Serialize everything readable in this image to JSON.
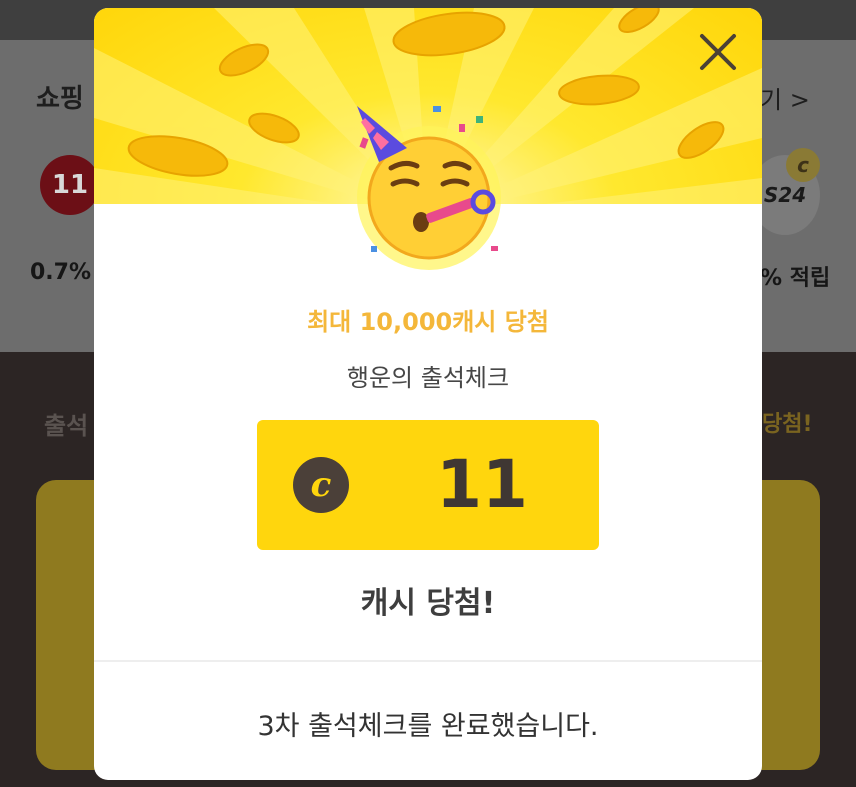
{
  "background": {
    "section_title": "쇼핑",
    "more_link": "기 >",
    "left_store_logo": "11",
    "right_store_logo": "S24",
    "right_coin_symbol": "c",
    "left_reward": "0.7%",
    "right_reward": "% 적립",
    "section2_left": "출석",
    "section2_right": "당첨!"
  },
  "modal": {
    "close_icon": "close-icon",
    "emoji_icon": "partying-face-icon",
    "subtitle": "최대 10,000캐시 당첨",
    "title": "행운의 출석체크",
    "cash": {
      "icon_symbol": "c",
      "amount": "11"
    },
    "win_label": "캐시 당첨!",
    "completion_message": "3차 출석체크를 완료했습니다."
  },
  "colors": {
    "accent_yellow": "#ffd60d",
    "subtitle_orange": "#f4b73a",
    "coin_brown": "#4b4039"
  }
}
